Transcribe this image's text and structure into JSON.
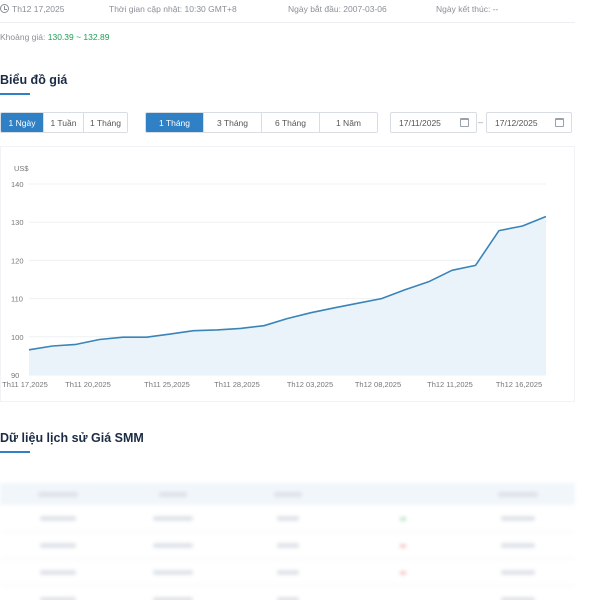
{
  "info_bar": {
    "date": "Th12 17,2025",
    "updated": "Thời gian cập nhật: 10:30 GMT+8",
    "start": "Ngày bắt đầu: 2007-03-06",
    "end": "Ngày kết thúc: --"
  },
  "price_range": {
    "label": "Khoảng giá:",
    "value": "130.39 ~ 132.89"
  },
  "chart_section": {
    "title": "Biểu đồ giá",
    "interval_buttons": [
      {
        "label": "1 Ngày",
        "active": true
      },
      {
        "label": "1 Tuần",
        "active": false
      },
      {
        "label": "1 Tháng",
        "active": false
      }
    ],
    "period_buttons": [
      {
        "label": "1 Tháng",
        "active": true
      },
      {
        "label": "3 Tháng",
        "active": false
      },
      {
        "label": "6 Tháng",
        "active": false
      },
      {
        "label": "1 Năm",
        "active": false
      }
    ],
    "date_from": "17/11/2025",
    "date_to": "17/12/2025",
    "date_separator": "–"
  },
  "chart_data": {
    "type": "area",
    "title": "",
    "xlabel": "",
    "ylabel": "",
    "unit": "US$",
    "ylim": [
      90,
      140
    ],
    "yticks": [
      90,
      100,
      110,
      120,
      130,
      140
    ],
    "x_tick_labels": [
      "Th11 17,2025",
      "Th11 20,2025",
      "Th11 25,2025",
      "Th11 28,2025",
      "Th12 03,2025",
      "Th12 08,2025",
      "Th12 11,2025",
      "Th12 16,2025"
    ],
    "x": [
      "Th11 17,2025",
      "Th11 18,2025",
      "Th11 19,2025",
      "Th11 20,2025",
      "Th11 21,2025",
      "Th11 24,2025",
      "Th11 25,2025",
      "Th11 26,2025",
      "Th11 27,2025",
      "Th11 28,2025",
      "Th12 01,2025",
      "Th12 02,2025",
      "Th12 03,2025",
      "Th12 04,2025",
      "Th12 05,2025",
      "Th12 08,2025",
      "Th12 09,2025",
      "Th12 10,2025",
      "Th12 11,2025",
      "Th12 12,2025",
      "Th12 15,2025",
      "Th12 16,2025",
      "Th12 17,2025"
    ],
    "series": [
      {
        "values": [
          96.6,
          97.6,
          98.0,
          99.3,
          99.9,
          99.9,
          100.7,
          101.6,
          101.8,
          102.2,
          102.9,
          104.8,
          106.3,
          107.6,
          108.8,
          110.0,
          112.3,
          114.4,
          117.4,
          118.7,
          127.8,
          129.0,
          131.5
        ]
      }
    ],
    "line_color": "#3a84b8",
    "fill_color": "#eaf3fa",
    "grid": true
  },
  "history_section": {
    "title": "Dữ liệu lịch sử Giá SMM"
  }
}
